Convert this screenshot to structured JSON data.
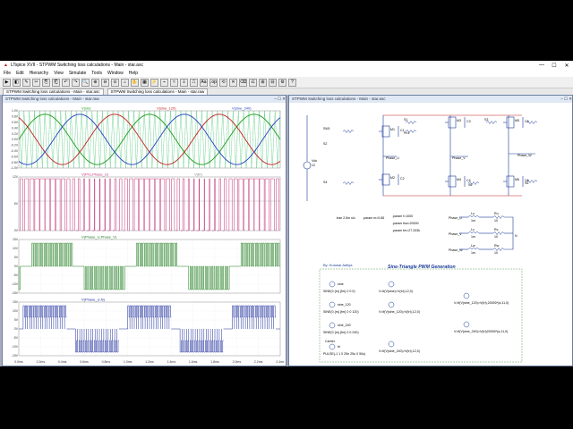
{
  "app": {
    "title": "LTspice XVII - STPWM Switching loss calculations - Main - star.asc",
    "icon": "ltspice-icon"
  },
  "menu": [
    "File",
    "Edit",
    "Hierarchy",
    "View",
    "Simulate",
    "Tools",
    "Window",
    "Help"
  ],
  "tabs": [
    "STPWM Switching loss calculations - Main - star.asc",
    "STPWM Switching loss calculations - Main - star.raw"
  ],
  "plot_window": {
    "title": "STPWM Switching loss calculations - Main - star.raw",
    "pane1": {
      "traces": [
        {
          "label": "V(sin)",
          "color": "#1a9a1a"
        },
        {
          "label": "V(sine_120)",
          "color": "#c02020"
        },
        {
          "label": "V(sine_240)",
          "color": "#2040c0"
        }
      ],
      "yticks": [
        "1.0V",
        "0.8V",
        "0.6V",
        "0.4V",
        "0.2V",
        "0.0V",
        "-0.2V",
        "-0.4V",
        "-0.6V",
        "-0.8V",
        "-1.0V"
      ]
    },
    "pane2": {
      "traces": [
        {
          "label": "V(Ph1,Phase_U)",
          "color": "#c03070"
        },
        {
          "label": "V(tri)",
          "color": "#808080"
        }
      ],
      "yticks": [
        "12V",
        "",
        "6V",
        "",
        "0V"
      ]
    },
    "pane3": {
      "traces": [
        {
          "label": "V(Phase_U,Phase_V)",
          "color": "#1a7a1a"
        }
      ],
      "yticks": [
        "15V",
        "10V",
        "5V",
        "0V",
        "-5V",
        "-10V",
        "-15V"
      ]
    },
    "pane4": {
      "traces": [
        {
          "label": "V(Phase_U,N)",
          "color": "#1a2a9a"
        }
      ],
      "yticks": [
        "15V",
        "10V",
        "5V",
        "0V",
        "-5V",
        "-10V",
        "-15V"
      ]
    },
    "xticks": [
      "0.0ms",
      "0.2ms",
      "0.4ms",
      "0.6ms",
      "0.8ms",
      "1.0ms",
      "1.2ms",
      "1.4ms",
      "1.6ms",
      "1.8ms",
      "2.0ms",
      "2.2ms",
      "2.4ms"
    ]
  },
  "schematic_window": {
    "title": "STPWM Switching loss calculations - Main - star.asc",
    "labels": {
      "vdc": "Vdc",
      "vdc_val": "12",
      "ph1": "Ph1",
      "ph1_val": "PH1",
      "sw": "SW1",
      "s1": "S1",
      "s2": "S2",
      "s3": "S3",
      "s4": "S4",
      "s5": "S5",
      "s6": "S6",
      "phase_u": "Phase_U",
      "phase_v": "Phase_V",
      "phase_w": "Phase_W",
      "m1": "M1",
      "m2": "M2",
      "m3": "M3",
      "m4": "M4",
      "m5": "M5",
      "m6": "M6",
      "c1": "C1",
      "c2": "C2",
      "c3": "C3",
      "c4": "C4",
      "c5": "C5",
      "c6": "C6",
      "tran": ".tran 2.5m uic",
      "param_m": ".param m=0.85",
      "param_f": ".param f=1000",
      "param_fsw": ".param fsw=20000",
      "param_fm": ".param fm=27.333k",
      "lu": "Lu",
      "lv": "Lv",
      "lw": "Lw",
      "ru": "Ru",
      "rv": "Rv",
      "rw": "Rw",
      "lval": "1m",
      "rval": "10",
      "n": "N",
      "author": "By: Kunwar Aditya",
      "heading": "Sine-Triangle PWM Generation",
      "v_sin": "SINE(0 {m} {fm} 0 0 0)",
      "v_sin120": "SINE(0 {m} {fm} 0 0 120)",
      "v_sin240": "SINE(0 {m} {fm} 0 0 240)",
      "v_tri": "PULSE(-1 1 0 25n 25u 0 50u)",
      "b1": "V=if(V(sine)>V(tri),12,0)",
      "b2": "V=if(V(sine_120)>V(tri),12,0)",
      "b3": "V=if(V(sine_240)>V(tri),12,0)",
      "b4": "V=if(V(sine_120)>V(tri),20000*(a,11,0)",
      "b5": "V=if(V(sine_240)>V(tri)20000*(a,11,0)",
      "sine": "sine",
      "sine_120": "sine_120",
      "sine_240": "sine_240",
      "tri": "tri",
      "carrier": "Carrier"
    }
  }
}
